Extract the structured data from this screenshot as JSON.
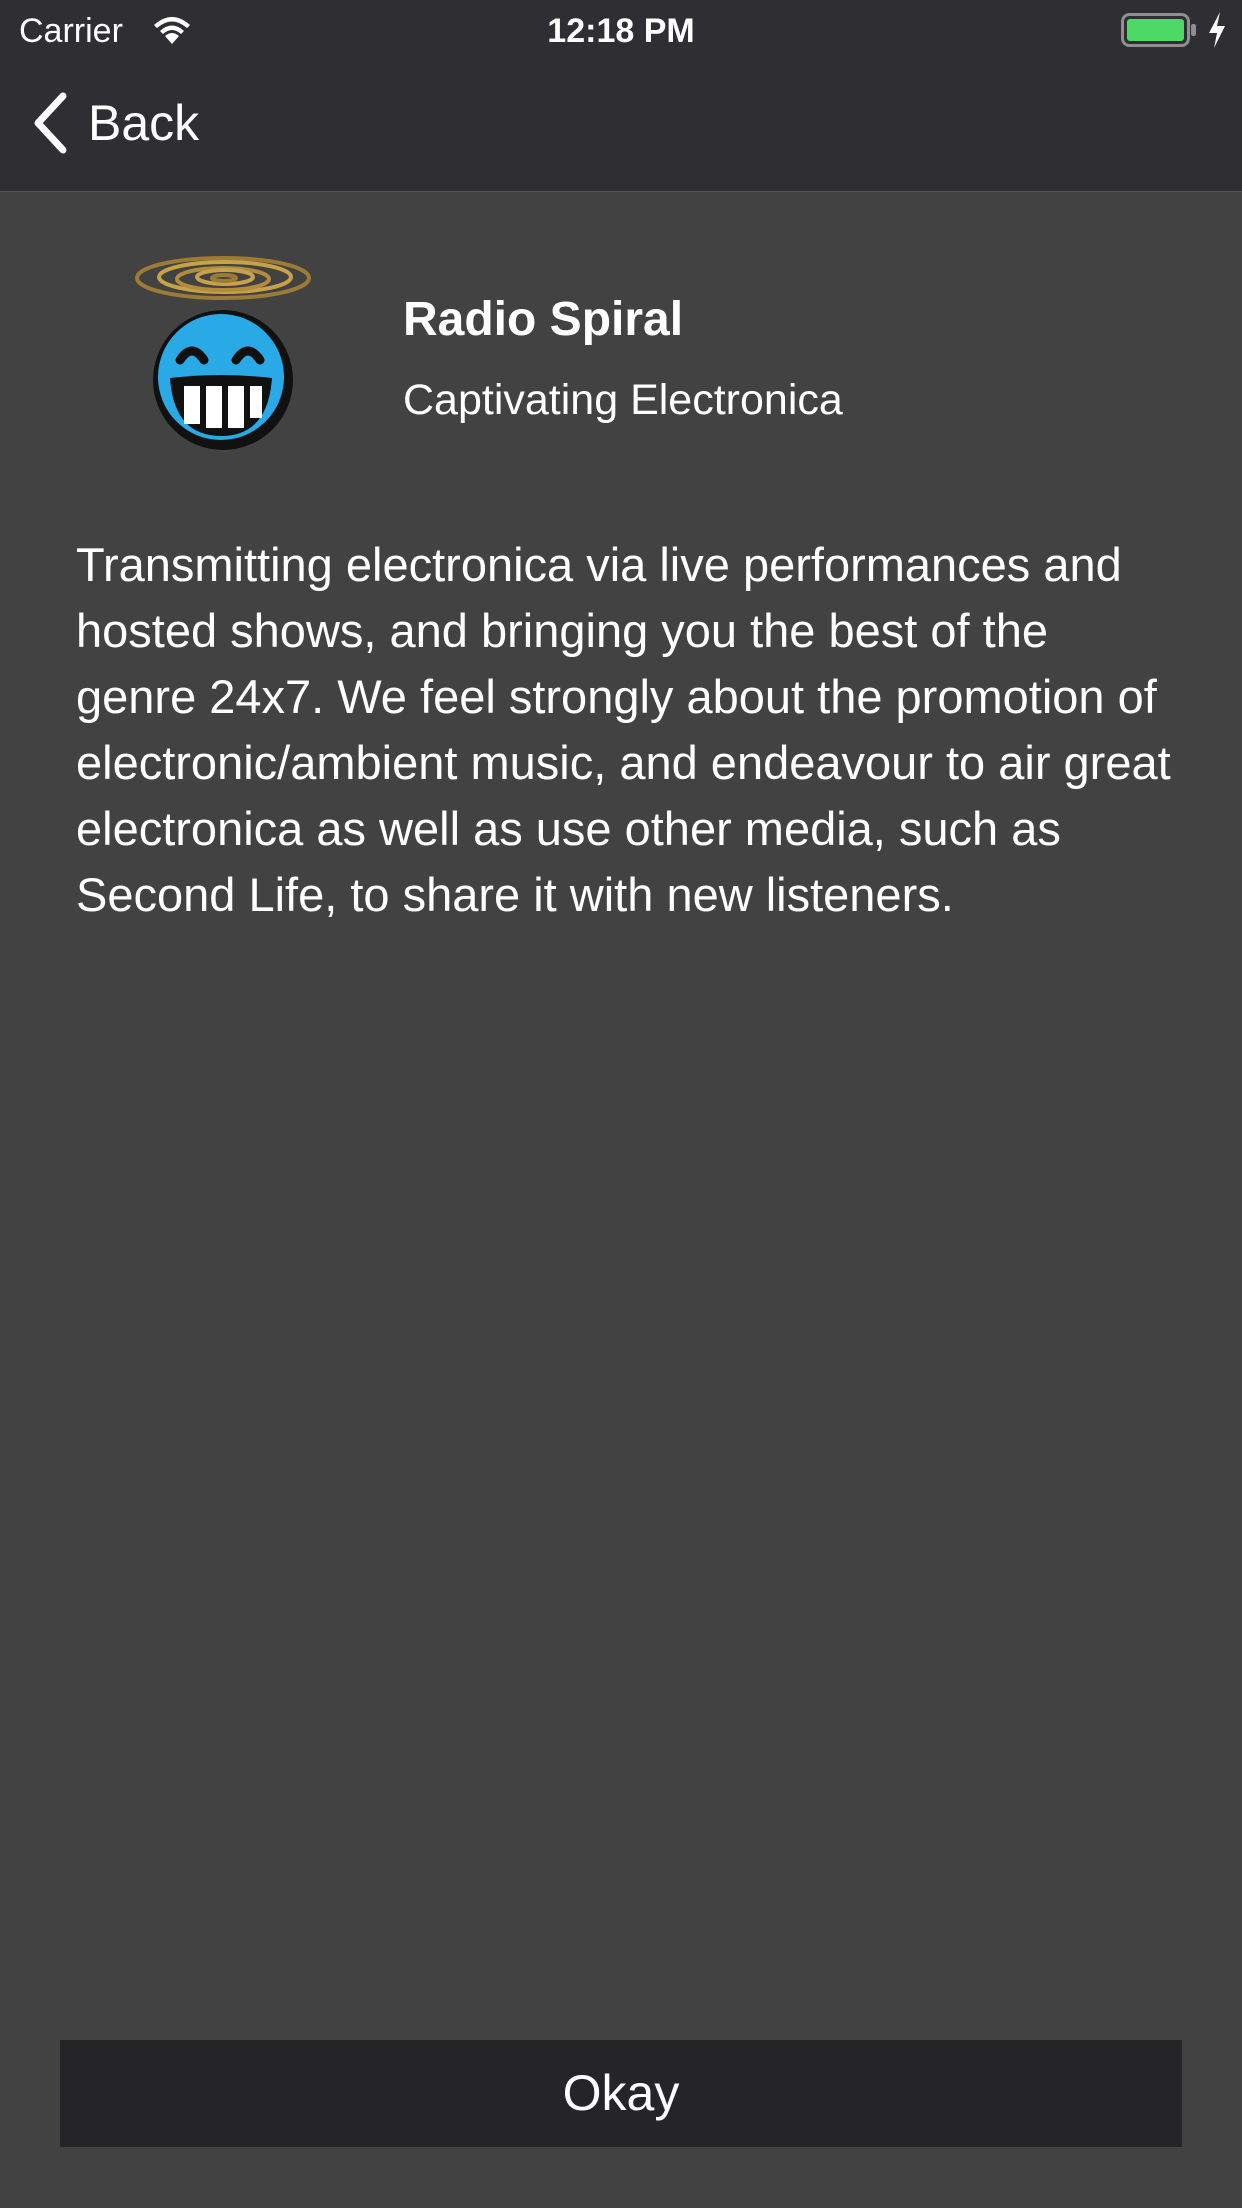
{
  "status_bar": {
    "carrier": "Carrier",
    "time": "12:18 PM",
    "wifi_icon": "wifi-icon",
    "battery_icon": "battery-icon",
    "charging_icon": "charging-bolt-icon",
    "battery_color": "#4cd964"
  },
  "nav": {
    "back_label": "Back",
    "back_icon": "chevron-left-icon"
  },
  "station": {
    "logo_icon": "grinning-face-with-spiral-halo-logo",
    "name": "Radio Spiral",
    "tagline": "Captivating Electronica",
    "description": "Transmitting electronica via live performances and hosted shows, and bringing you the best of the genre 24x7. We feel strongly about the promotion of electronic/ambient music, and endeavour to air great electronica as well as use other media, such as Second Life, to share it with new listeners."
  },
  "footer": {
    "okay_label": "Okay"
  },
  "colors": {
    "background": "#424242",
    "nav_background": "#2f2f33",
    "button_background": "#252528",
    "logo_face": "#29a9e6",
    "logo_halo": "#c8a24a",
    "text": "#ffffff"
  }
}
